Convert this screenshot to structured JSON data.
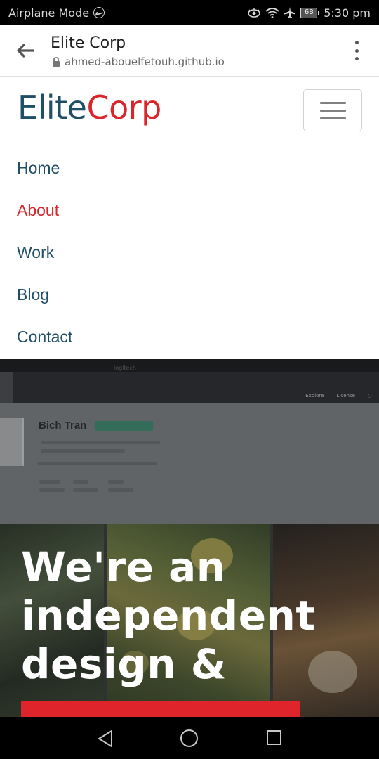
{
  "status_bar": {
    "carrier_text": "Airplane Mode",
    "battery_level": "68",
    "time": "5:30 pm",
    "icons": [
      "messenger-icon",
      "eye-comfort-icon",
      "wifi-icon",
      "airplane-icon",
      "battery-icon"
    ]
  },
  "browser": {
    "page_title": "Elite Corp",
    "url": "ahmed-abouelfetouh.github.io",
    "icons": [
      "back-arrow-icon",
      "lock-icon",
      "overflow-menu-icon"
    ]
  },
  "site": {
    "logo_part1": "Elite",
    "logo_part2": "Corp",
    "nav_items": [
      {
        "label": "Home",
        "active": false
      },
      {
        "label": "About",
        "active": true
      },
      {
        "label": "Work",
        "active": false
      },
      {
        "label": "Blog",
        "active": false
      },
      {
        "label": "Contact",
        "active": false
      }
    ],
    "colors": {
      "brand_blue": "#1f4e67",
      "brand_red": "#d9262b"
    }
  },
  "hero": {
    "background_profile_name": "Bich Tran",
    "heading_line1": "We're an",
    "heading_line2": "independent",
    "heading_line3": "design &"
  },
  "android_nav": {
    "icons": [
      "nav-back-icon",
      "nav-home-icon",
      "nav-recents-icon"
    ]
  }
}
